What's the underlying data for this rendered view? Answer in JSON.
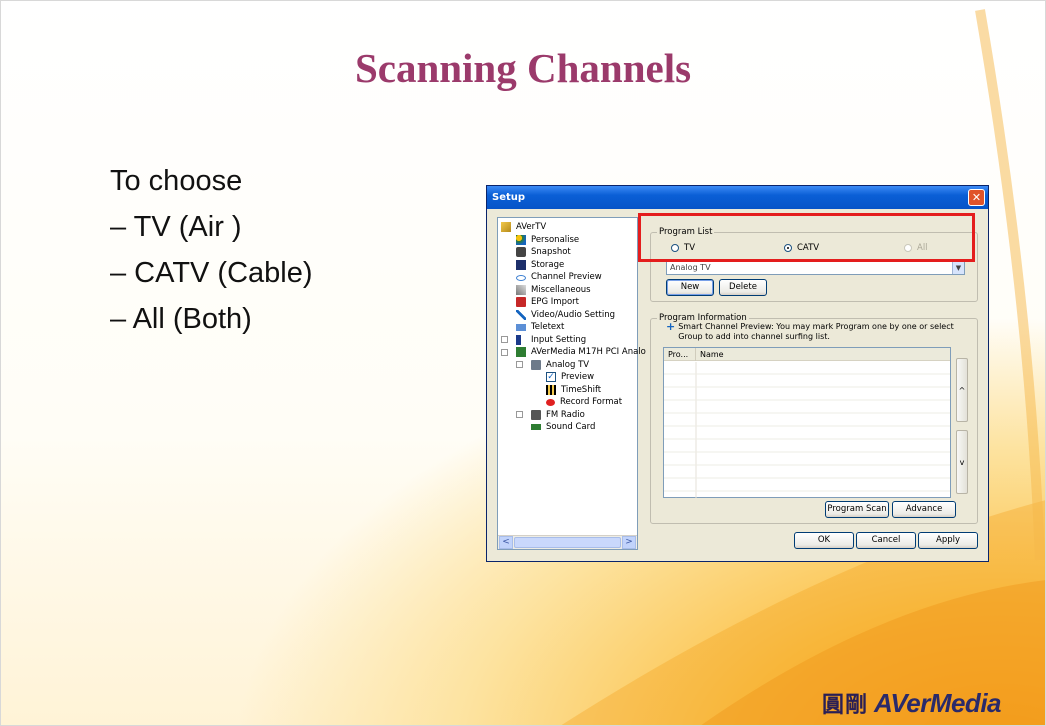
{
  "slide": {
    "title": "Scanning Channels",
    "bullets": [
      "To choose",
      "– TV (Air )",
      "– CATV (Cable)",
      "– All (Both)"
    ],
    "logo_cn": "圓剛",
    "logo_brand": "AVerMedia"
  },
  "dialog": {
    "title": "Setup",
    "close_label": "✕",
    "tree": [
      {
        "label": "AVerTV",
        "icon": "avertv-icon"
      },
      {
        "label": "Personalise",
        "icon": "personalise-icon"
      },
      {
        "label": "Snapshot",
        "icon": "snapshot-icon"
      },
      {
        "label": "Storage",
        "icon": "storage-icon"
      },
      {
        "label": "Channel Preview",
        "icon": "eye-icon"
      },
      {
        "label": "Miscellaneous",
        "icon": "misc-icon"
      },
      {
        "label": "EPG Import",
        "icon": "epg-icon"
      },
      {
        "label": "Video/Audio Setting",
        "icon": "tools-icon"
      },
      {
        "label": "Teletext",
        "icon": "teletext-icon"
      },
      {
        "label": "Input Setting",
        "icon": "input-icon"
      },
      {
        "label": "AVerMedia M17H PCI Analo",
        "icon": "card-icon"
      },
      {
        "label": "Analog TV",
        "icon": "tv-icon"
      },
      {
        "label": "Preview",
        "icon": "checkbox-icon"
      },
      {
        "label": "TimeShift",
        "icon": "timeshift-icon"
      },
      {
        "label": "Record Format",
        "icon": "record-icon"
      },
      {
        "label": "FM Radio",
        "icon": "radio-icon"
      },
      {
        "label": "Sound Card",
        "icon": "soundcard-icon"
      }
    ],
    "tree_scroll_left": "<",
    "tree_scroll_right": ">",
    "program_list": {
      "label": "Program List",
      "options": [
        "TV",
        "CATV",
        "All"
      ],
      "selected": "CATV",
      "source_value": "Analog TV",
      "combo_arrow": "▼",
      "new_label": "New",
      "delete_label": "Delete"
    },
    "program_info": {
      "label": "Program Information",
      "hint": "Smart Channel Preview: You may mark Program one by one or select Group to add into channel surfing list.",
      "col_program": "Pro...",
      "col_name": "Name",
      "up_label": "^",
      "down_label": "v",
      "scan_label": "Program Scan",
      "advance_label": "Advance"
    },
    "ok_label": "OK",
    "cancel_label": "Cancel",
    "apply_label": "Apply"
  },
  "colors": {
    "title": "#9b3a6b",
    "highlight": "#e41d1d",
    "titlebar": "#0a5fd6"
  }
}
